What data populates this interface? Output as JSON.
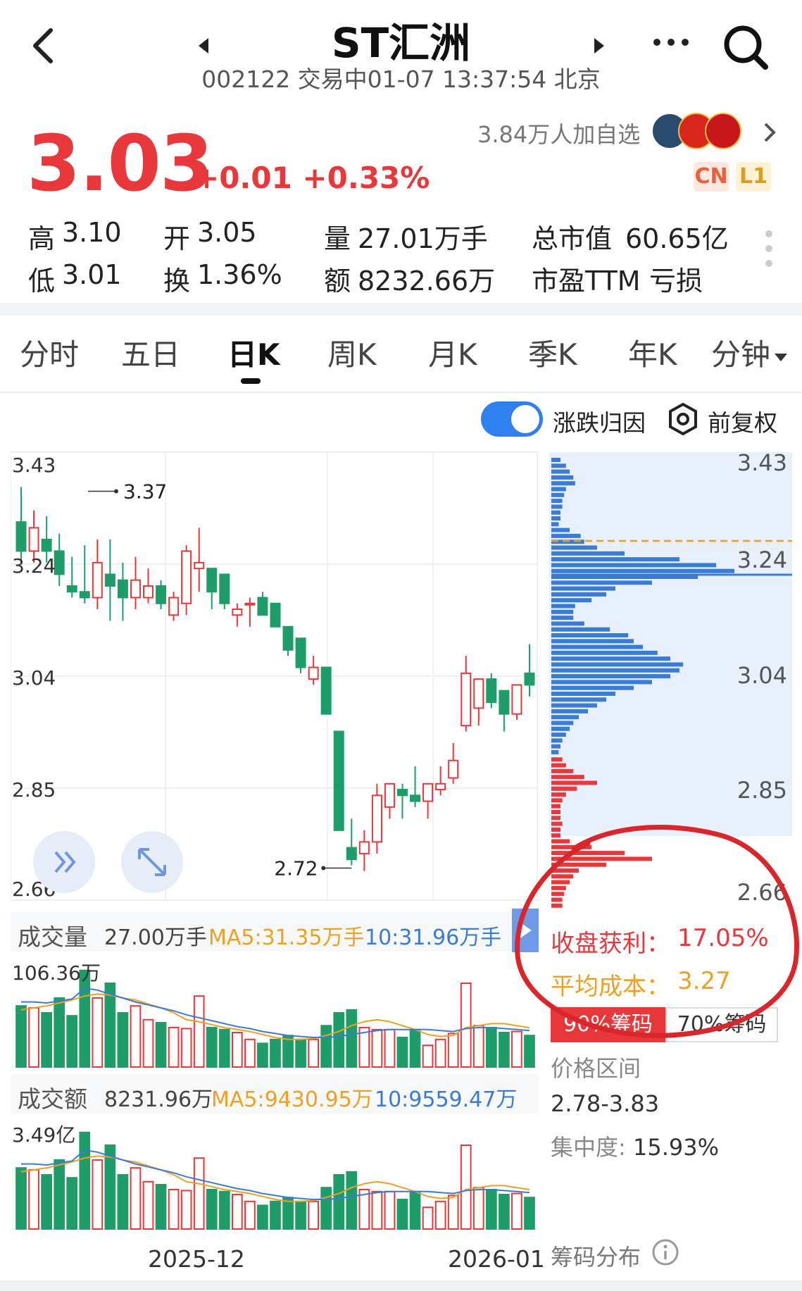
{
  "header": {
    "title": "ST汇洲",
    "subtitle": "002122 交易中01-07 13:37:54 北京"
  },
  "quote": {
    "price": "3.03",
    "change": "+0.01",
    "change_pct": "+0.33%",
    "watchers": "3.84万人加自选",
    "badge_cn": "CN",
    "badge_l1": "L1",
    "stats": {
      "high_label": "高",
      "high": "3.10",
      "open_label": "开",
      "open": "3.05",
      "volume_label": "量",
      "volume": "27.01万手",
      "mcap_label": "总市值",
      "mcap": "60.65亿",
      "low_label": "低",
      "low": "3.01",
      "turnover_label": "换",
      "turnover": "1.36%",
      "amount_label": "额",
      "amount": "8232.66万",
      "pe_label": "市盈TTM",
      "pe": "亏损"
    }
  },
  "tabs": [
    {
      "label": "分时",
      "active": false
    },
    {
      "label": "五日",
      "active": false
    },
    {
      "label": "日K",
      "active": true
    },
    {
      "label": "周K",
      "active": false
    },
    {
      "label": "月K",
      "active": false
    },
    {
      "label": "季K",
      "active": false
    },
    {
      "label": "年K",
      "active": false
    },
    {
      "label": "分钟",
      "active": false
    }
  ],
  "options": {
    "attribution_label": "涨跌归因",
    "attribution_on": true,
    "adjust_label": "前复权"
  },
  "chart_data": {
    "type": "candlestick",
    "price_axis": [
      "3.43",
      "3.24",
      "3.04",
      "2.85",
      "2.66"
    ],
    "ylim": [
      2.66,
      3.43
    ],
    "marked_high": "3.37",
    "marked_low": "2.72",
    "x_labels": [
      "2025-12",
      "2026-01"
    ],
    "candles": [
      {
        "o": 3.31,
        "h": 3.37,
        "l": 3.24,
        "c": 3.26
      },
      {
        "o": 3.26,
        "h": 3.33,
        "l": 3.24,
        "c": 3.3
      },
      {
        "o": 3.28,
        "h": 3.32,
        "l": 3.24,
        "c": 3.26
      },
      {
        "o": 3.26,
        "h": 3.29,
        "l": 3.2,
        "c": 3.22
      },
      {
        "o": 3.2,
        "h": 3.25,
        "l": 3.18,
        "c": 3.19
      },
      {
        "o": 3.19,
        "h": 3.27,
        "l": 3.17,
        "c": 3.18
      },
      {
        "o": 3.18,
        "h": 3.28,
        "l": 3.16,
        "c": 3.24
      },
      {
        "o": 3.22,
        "h": 3.28,
        "l": 3.14,
        "c": 3.2
      },
      {
        "o": 3.21,
        "h": 3.24,
        "l": 3.14,
        "c": 3.18
      },
      {
        "o": 3.18,
        "h": 3.25,
        "l": 3.16,
        "c": 3.21
      },
      {
        "o": 3.18,
        "h": 3.23,
        "l": 3.17,
        "c": 3.2
      },
      {
        "o": 3.2,
        "h": 3.21,
        "l": 3.16,
        "c": 3.17
      },
      {
        "o": 3.15,
        "h": 3.19,
        "l": 3.14,
        "c": 3.18
      },
      {
        "o": 3.17,
        "h": 3.27,
        "l": 3.15,
        "c": 3.26
      },
      {
        "o": 3.23,
        "h": 3.3,
        "l": 3.19,
        "c": 3.24
      },
      {
        "o": 3.23,
        "h": 3.23,
        "l": 3.16,
        "c": 3.19
      },
      {
        "o": 3.22,
        "h": 3.22,
        "l": 3.16,
        "c": 3.17
      },
      {
        "o": 3.15,
        "h": 3.17,
        "l": 3.13,
        "c": 3.16
      },
      {
        "o": 3.17,
        "h": 3.18,
        "l": 3.13,
        "c": 3.17
      },
      {
        "o": 3.18,
        "h": 3.19,
        "l": 3.16,
        "c": 3.15
      },
      {
        "o": 3.17,
        "h": 3.17,
        "l": 3.13,
        "c": 3.13
      },
      {
        "o": 3.13,
        "h": 3.13,
        "l": 3.08,
        "c": 3.09
      },
      {
        "o": 3.11,
        "h": 3.11,
        "l": 3.05,
        "c": 3.06
      },
      {
        "o": 3.04,
        "h": 3.08,
        "l": 3.03,
        "c": 3.06
      },
      {
        "o": 3.06,
        "h": 3.06,
        "l": 2.98,
        "c": 2.98
      },
      {
        "o": 2.95,
        "h": 2.95,
        "l": 2.78,
        "c": 2.78
      },
      {
        "o": 2.75,
        "h": 2.8,
        "l": 2.72,
        "c": 2.73
      },
      {
        "o": 2.74,
        "h": 2.78,
        "l": 2.71,
        "c": 2.76
      },
      {
        "o": 2.76,
        "h": 2.86,
        "l": 2.74,
        "c": 2.84
      },
      {
        "o": 2.82,
        "h": 2.86,
        "l": 2.8,
        "c": 2.86
      },
      {
        "o": 2.85,
        "h": 2.86,
        "l": 2.8,
        "c": 2.84
      },
      {
        "o": 2.84,
        "h": 2.89,
        "l": 2.82,
        "c": 2.83
      },
      {
        "o": 2.83,
        "h": 2.86,
        "l": 2.8,
        "c": 2.86
      },
      {
        "o": 2.85,
        "h": 2.89,
        "l": 2.84,
        "c": 2.86
      },
      {
        "o": 2.87,
        "h": 2.93,
        "l": 2.86,
        "c": 2.9
      },
      {
        "o": 2.96,
        "h": 3.08,
        "l": 2.95,
        "c": 3.05
      },
      {
        "o": 2.99,
        "h": 3.04,
        "l": 2.96,
        "c": 3.04
      },
      {
        "o": 3.04,
        "h": 3.05,
        "l": 2.99,
        "c": 3.0
      },
      {
        "o": 3.02,
        "h": 3.02,
        "l": 2.95,
        "c": 2.98
      },
      {
        "o": 2.98,
        "h": 3.03,
        "l": 2.97,
        "c": 3.03
      },
      {
        "o": 3.05,
        "h": 3.1,
        "l": 3.01,
        "c": 3.03
      }
    ],
    "volume_panel": {
      "label": "成交量",
      "current": "27.00万手",
      "ma5": "MA5:31.35万手",
      "ma10": "10:31.96万手",
      "max_label": "106.36万"
    },
    "amount_panel": {
      "label": "成交额",
      "current": "8231.96万",
      "ma5": "MA5:9430.95万",
      "ma10": "10:9559.47万",
      "max_label": "3.49亿"
    },
    "volumes": [
      0.62,
      0.6,
      0.55,
      0.7,
      0.52,
      0.98,
      0.7,
      0.85,
      0.55,
      0.62,
      0.48,
      0.45,
      0.4,
      0.39,
      0.72,
      0.4,
      0.38,
      0.35,
      0.28,
      0.24,
      0.28,
      0.32,
      0.28,
      0.28,
      0.42,
      0.55,
      0.58,
      0.4,
      0.38,
      0.38,
      0.3,
      0.38,
      0.22,
      0.28,
      0.34,
      0.85,
      0.42,
      0.4,
      0.35,
      0.36,
      0.32
    ],
    "vol_ma5": [
      0.58,
      0.6,
      0.62,
      0.65,
      0.68,
      0.72,
      0.74,
      0.73,
      0.7,
      0.68,
      0.64,
      0.6,
      0.55,
      0.48,
      0.46,
      0.43,
      0.4,
      0.38,
      0.36,
      0.33,
      0.3,
      0.28,
      0.28,
      0.29,
      0.32,
      0.36,
      0.42,
      0.46,
      0.48,
      0.46,
      0.42,
      0.38,
      0.33,
      0.31,
      0.32,
      0.4,
      0.42,
      0.44,
      0.44,
      0.42,
      0.4
    ],
    "vol_ma10": [
      0.66,
      0.66,
      0.65,
      0.67,
      0.69,
      0.8,
      0.78,
      0.74,
      0.7,
      0.66,
      0.63,
      0.6,
      0.57,
      0.53,
      0.5,
      0.47,
      0.44,
      0.41,
      0.39,
      0.36,
      0.34,
      0.32,
      0.31,
      0.3,
      0.3,
      0.31,
      0.33,
      0.35,
      0.37,
      0.38,
      0.38,
      0.38,
      0.38,
      0.37,
      0.36,
      0.39,
      0.4,
      0.4,
      0.39,
      0.38,
      0.37
    ]
  },
  "chips": {
    "price_labels": [
      "3.43",
      "3.24",
      "3.04",
      "2.85",
      "2.66"
    ],
    "profit_label": "收盘获利：",
    "profit_value": "17.05%",
    "avg_cost_label": "平均成本：",
    "avg_cost_value": "3.27",
    "tab_90": "90%筹码",
    "tab_70": "70%筹码",
    "range_label": "价格区间",
    "range_value": "2.78-3.83",
    "concentration_label": "集中度:",
    "concentration_value": "15.93%",
    "footer_label": "筹码分布",
    "bars_profit": [
      0.05,
      0.1,
      0.1,
      0.12,
      0.18,
      0.28,
      0.45,
      0.22,
      0.15,
      0.1,
      0.08,
      0.08,
      0.07,
      0.06,
      0.05
    ],
    "bars_loss": [
      0.05,
      0.08,
      0.1,
      0.12,
      0.13,
      0.08,
      0.07,
      0.06,
      0.06,
      0.05,
      0.05,
      0.04,
      0.1,
      0.16,
      0.18,
      0.25,
      0.4,
      0.7,
      0.9,
      1.0,
      0.8,
      0.55,
      0.35,
      0.3,
      0.22,
      0.13,
      0.12,
      0.12,
      0.18,
      0.32,
      0.42,
      0.45,
      0.5,
      0.58,
      0.65,
      0.72,
      0.7,
      0.65,
      0.55,
      0.45,
      0.35,
      0.3,
      0.25,
      0.2,
      0.15,
      0.12,
      0.1,
      0.08,
      0.06,
      0.05,
      0.04
    ]
  },
  "colors": {
    "up": "#e8383c",
    "down": "#1e9d6a",
    "ma5": "#f0a020",
    "ma10": "#3a7bd5",
    "chip_loss": "#3a7bd5",
    "chip_profit": "#e8383c",
    "chip_bg": "#e8f0fc"
  }
}
